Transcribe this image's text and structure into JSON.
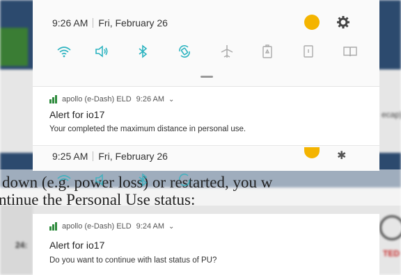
{
  "status_bar": {
    "time": "9:26 AM",
    "date": "Fri, February 26"
  },
  "status_bar_2": {
    "time": "9:25 AM",
    "date": "Fri, February 26"
  },
  "quick_settings": [
    "wifi-icon",
    "sound-icon",
    "bluetooth-icon",
    "auto-rotate-icon",
    "airplane-mode-icon",
    "battery-saver-icon",
    "flashlight-icon",
    "book-icon"
  ],
  "notification_1": {
    "app_name": "apollo (e-Dash) ELD",
    "time": "9:26 AM",
    "title": "Alert for io17",
    "body": "Your completed the maximum distance in personal use."
  },
  "notification_2": {
    "app_name": "apollo (e-Dash) ELD",
    "time": "9:24 AM",
    "title": "Alert for io17",
    "body": "Do you want to continue with last status of PU?"
  },
  "document_text": {
    "line1": "down (e.g. power loss) or restarted, you w",
    "line2": "ntinue the Personal Use status:"
  },
  "background": {
    "side_text_1": "ecap)",
    "side_text_2": "24:",
    "side_text_3": "TED"
  },
  "colors": {
    "accent": "#2bb3c0",
    "brand_green": "#2e8b3d",
    "sun": "#f4b400"
  }
}
